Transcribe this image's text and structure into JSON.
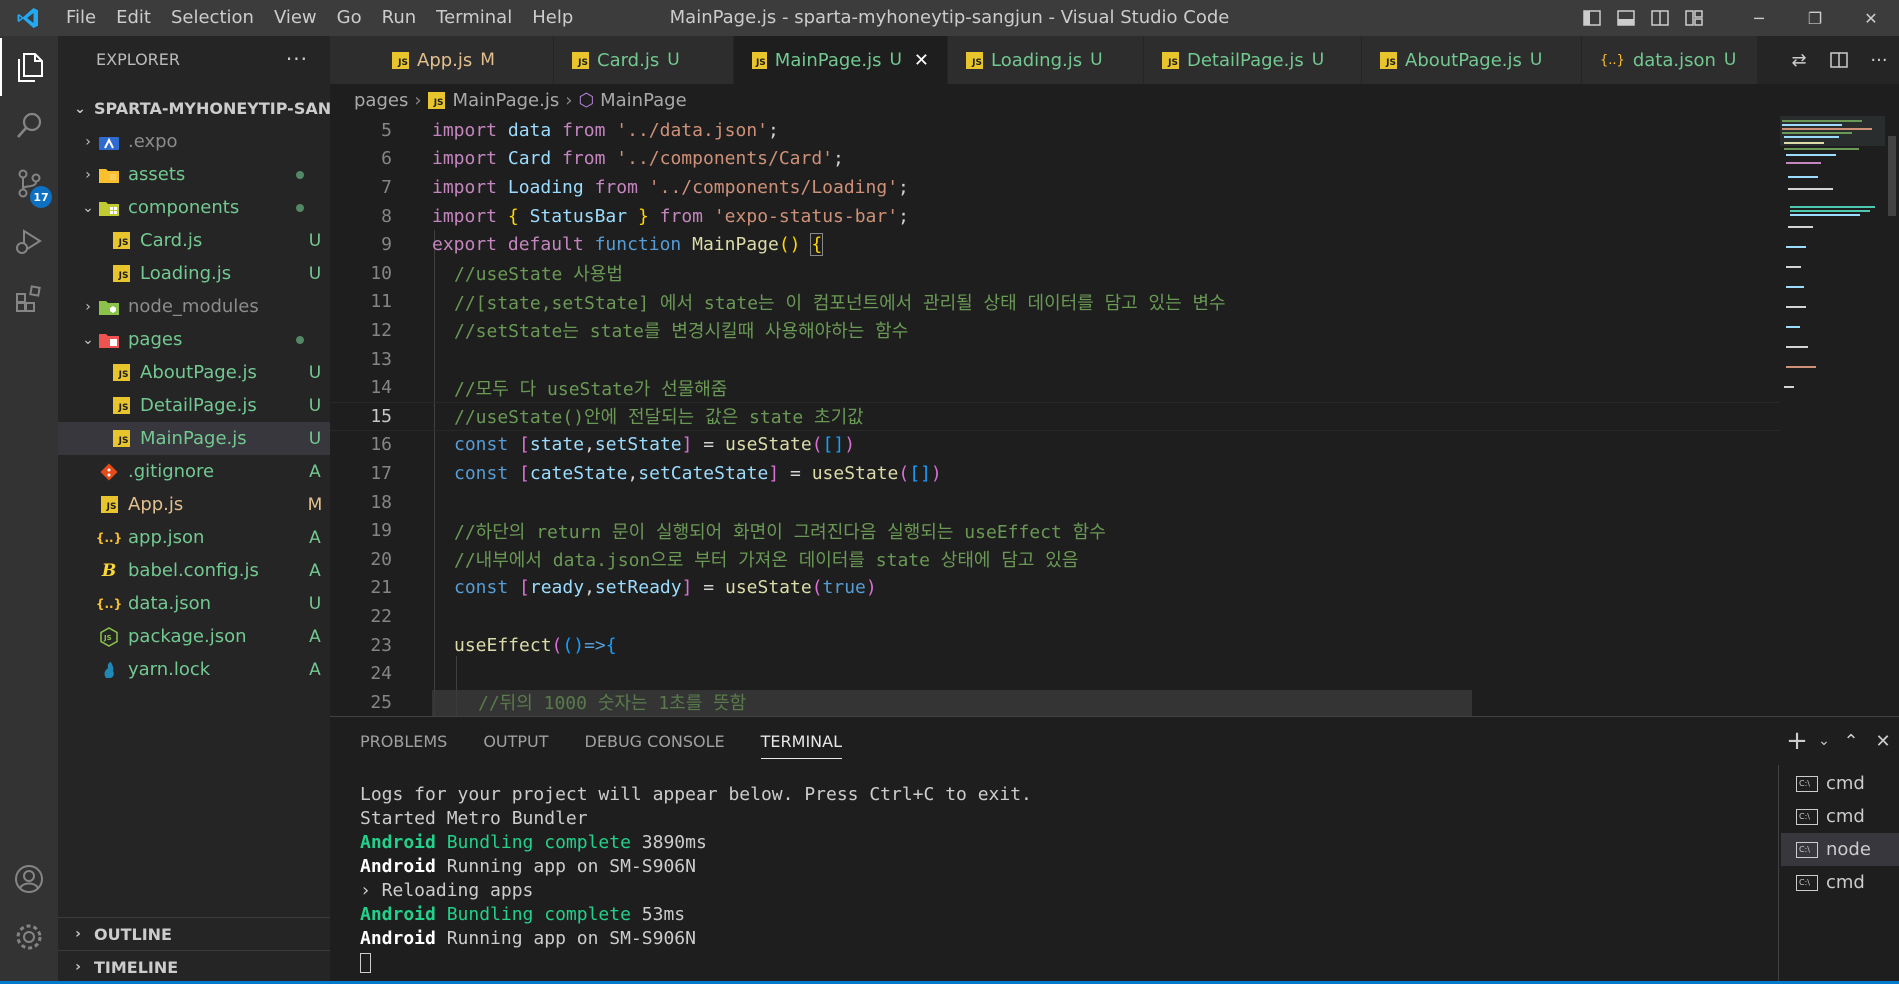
{
  "titlebar": {
    "menu": [
      "File",
      "Edit",
      "Selection",
      "View",
      "Go",
      "Run",
      "Terminal",
      "Help"
    ],
    "title": "MainPage.js - sparta-myhoneytip-sangjun - Visual Studio Code"
  },
  "activity": {
    "scm_badge": "17"
  },
  "explorer": {
    "header": "EXPLORER",
    "root": "SPARTA-MYHONEYTIP-SAN...",
    "items": [
      {
        "label": ".expo",
        "status": ""
      },
      {
        "label": "assets",
        "status": ""
      },
      {
        "label": "components",
        "status": ""
      },
      {
        "label": "Card.js",
        "status": "U"
      },
      {
        "label": "Loading.js",
        "status": "U"
      },
      {
        "label": "node_modules",
        "status": ""
      },
      {
        "label": "pages",
        "status": ""
      },
      {
        "label": "AboutPage.js",
        "status": "U"
      },
      {
        "label": "DetailPage.js",
        "status": "U"
      },
      {
        "label": "MainPage.js",
        "status": "U"
      },
      {
        "label": ".gitignore",
        "status": "A"
      },
      {
        "label": "App.js",
        "status": "M"
      },
      {
        "label": "app.json",
        "status": "A"
      },
      {
        "label": "babel.config.js",
        "status": "A"
      },
      {
        "label": "data.json",
        "status": "U"
      },
      {
        "label": "package.json",
        "status": "A"
      },
      {
        "label": "yarn.lock",
        "status": "A"
      }
    ],
    "outline": "OUTLINE",
    "timeline": "TIMELINE"
  },
  "tabs": [
    {
      "label": "App.js",
      "status": "M"
    },
    {
      "label": "Card.js",
      "status": "U"
    },
    {
      "label": "MainPage.js",
      "status": "U"
    },
    {
      "label": "Loading.js",
      "status": "U"
    },
    {
      "label": "DetailPage.js",
      "status": "U"
    },
    {
      "label": "AboutPage.js",
      "status": "U"
    },
    {
      "label": "data.json",
      "status": "U"
    }
  ],
  "breadcrumb": {
    "folder": "pages",
    "file": "MainPage.js",
    "symbol": "MainPage"
  },
  "editor": {
    "line_numbers": [
      "5",
      "6",
      "7",
      "8",
      "9",
      "10",
      "11",
      "12",
      "13",
      "14",
      "15",
      "16",
      "17",
      "18",
      "19",
      "20",
      "21",
      "22",
      "23",
      "24",
      "25"
    ],
    "comments": {
      "l10": "//useState 사용법",
      "l11": "//[state,setState] 에서 state는 이 컴포넌트에서 관리될 상태 데이터를 담고 있는 변수",
      "l12": "//setState는 state를 변경시킬때 사용해야하는 함수",
      "l14": "//모두 다 useState가 선물해줌",
      "l15": "//useState()안에 전달되는 값은 state 초기값",
      "l19": "//하단의 return 문이 실행되어 화면이 그려진다음 실행되는 useEffect 함수",
      "l20": "//내부에서 data.json으로 부터 가져온 데이터를 state 상태에 담고 있음",
      "l25": "//뒤의 1000 숫자는 1초를 뜻함"
    },
    "strings": {
      "data": "'../data.json'",
      "card": "'../components/Card'",
      "loading": "'../components/Loading'",
      "statusbar": "'expo-status-bar'"
    }
  },
  "panel": {
    "tabs": [
      "PROBLEMS",
      "OUTPUT",
      "DEBUG CONSOLE",
      "TERMINAL"
    ],
    "terminal": {
      "l1": "Logs for your project will appear below. Press Ctrl+C to exit.",
      "l2": "Started Metro Bundler",
      "android": "Android",
      "bundling": "Bundling complete",
      "t1": "3890ms",
      "running": "Running app on SM-S906N",
      "reloading": "› Reloading apps",
      "t2": "53ms"
    },
    "terminals": [
      "cmd",
      "cmd",
      "node",
      "cmd"
    ]
  },
  "colors": {
    "accent": "#007acc",
    "modified": "#e2c08d",
    "untracked": "#73c991"
  }
}
